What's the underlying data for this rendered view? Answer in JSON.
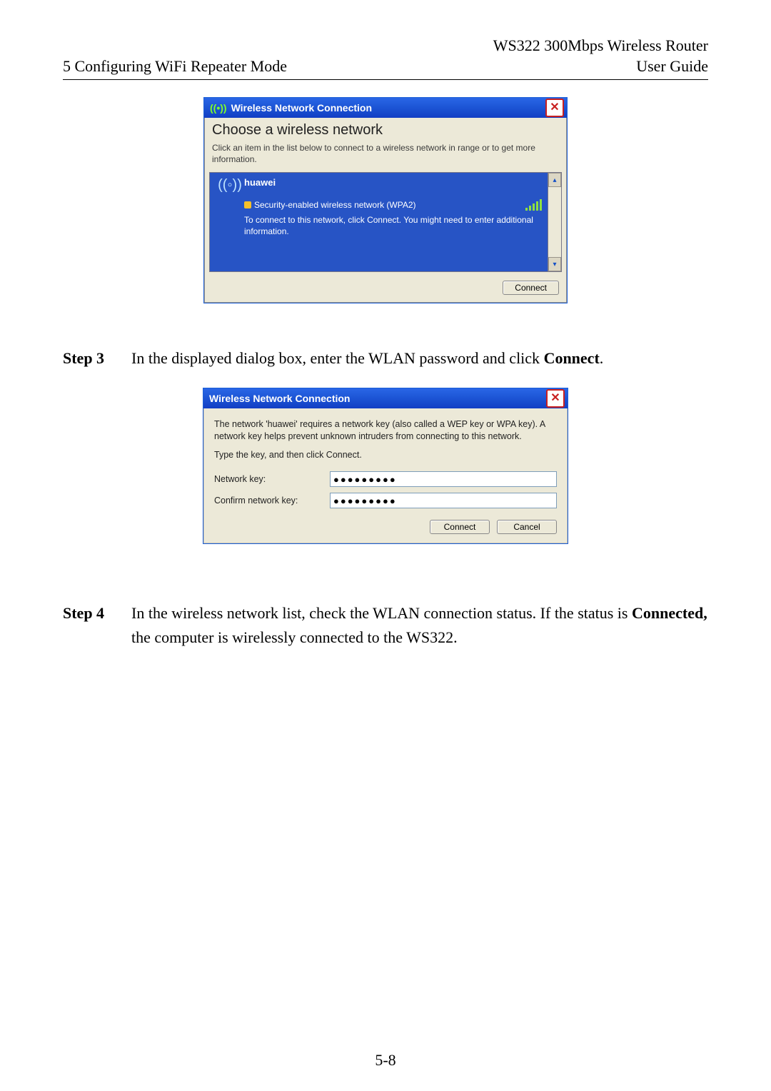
{
  "header": {
    "product": "WS322 300Mbps Wireless Router",
    "section": "5 Configuring WiFi Repeater Mode",
    "doc_type": "User Guide"
  },
  "dialog1": {
    "title_prefix_icon": "((•))",
    "title": "Wireless Network Connection",
    "choose_heading": "Choose a wireless network",
    "subtext": "Click an item in the list below to connect to a wireless network in range or to get more information.",
    "network": {
      "antenna_icon": "((◦))",
      "name": "huawei",
      "security_label": "Security-enabled wireless network (WPA2)",
      "hint": "To connect to this network, click Connect. You might need to enter additional information."
    },
    "scroll_up": "▴",
    "scroll_down": "▾",
    "connect_button": "Connect",
    "close_glyph": "✕"
  },
  "step3": {
    "label": "Step 3",
    "text_before": "In the displayed dialog box, enter the WLAN password and click ",
    "bold": "Connect",
    "text_after": "."
  },
  "dialog2": {
    "title": "Wireless Network Connection",
    "message": "The network 'huawei' requires a network key (also called a WEP key or WPA key). A network key helps prevent unknown intruders from connecting to this network.",
    "instructions": "Type the key, and then click Connect.",
    "field1_label": "Network key:",
    "field1_value": "●●●●●●●●●",
    "field2_label": "Confirm network key:",
    "field2_value": "●●●●●●●●●",
    "connect_button": "Connect",
    "cancel_button": "Cancel",
    "close_glyph": "✕"
  },
  "step4": {
    "label": "Step 4",
    "text_before": "In the wireless network list, check the WLAN connection status. If the status is ",
    "bold": "Connected,",
    "text_after": " the computer is wirelessly connected to the WS322."
  },
  "page_number": "5-8"
}
